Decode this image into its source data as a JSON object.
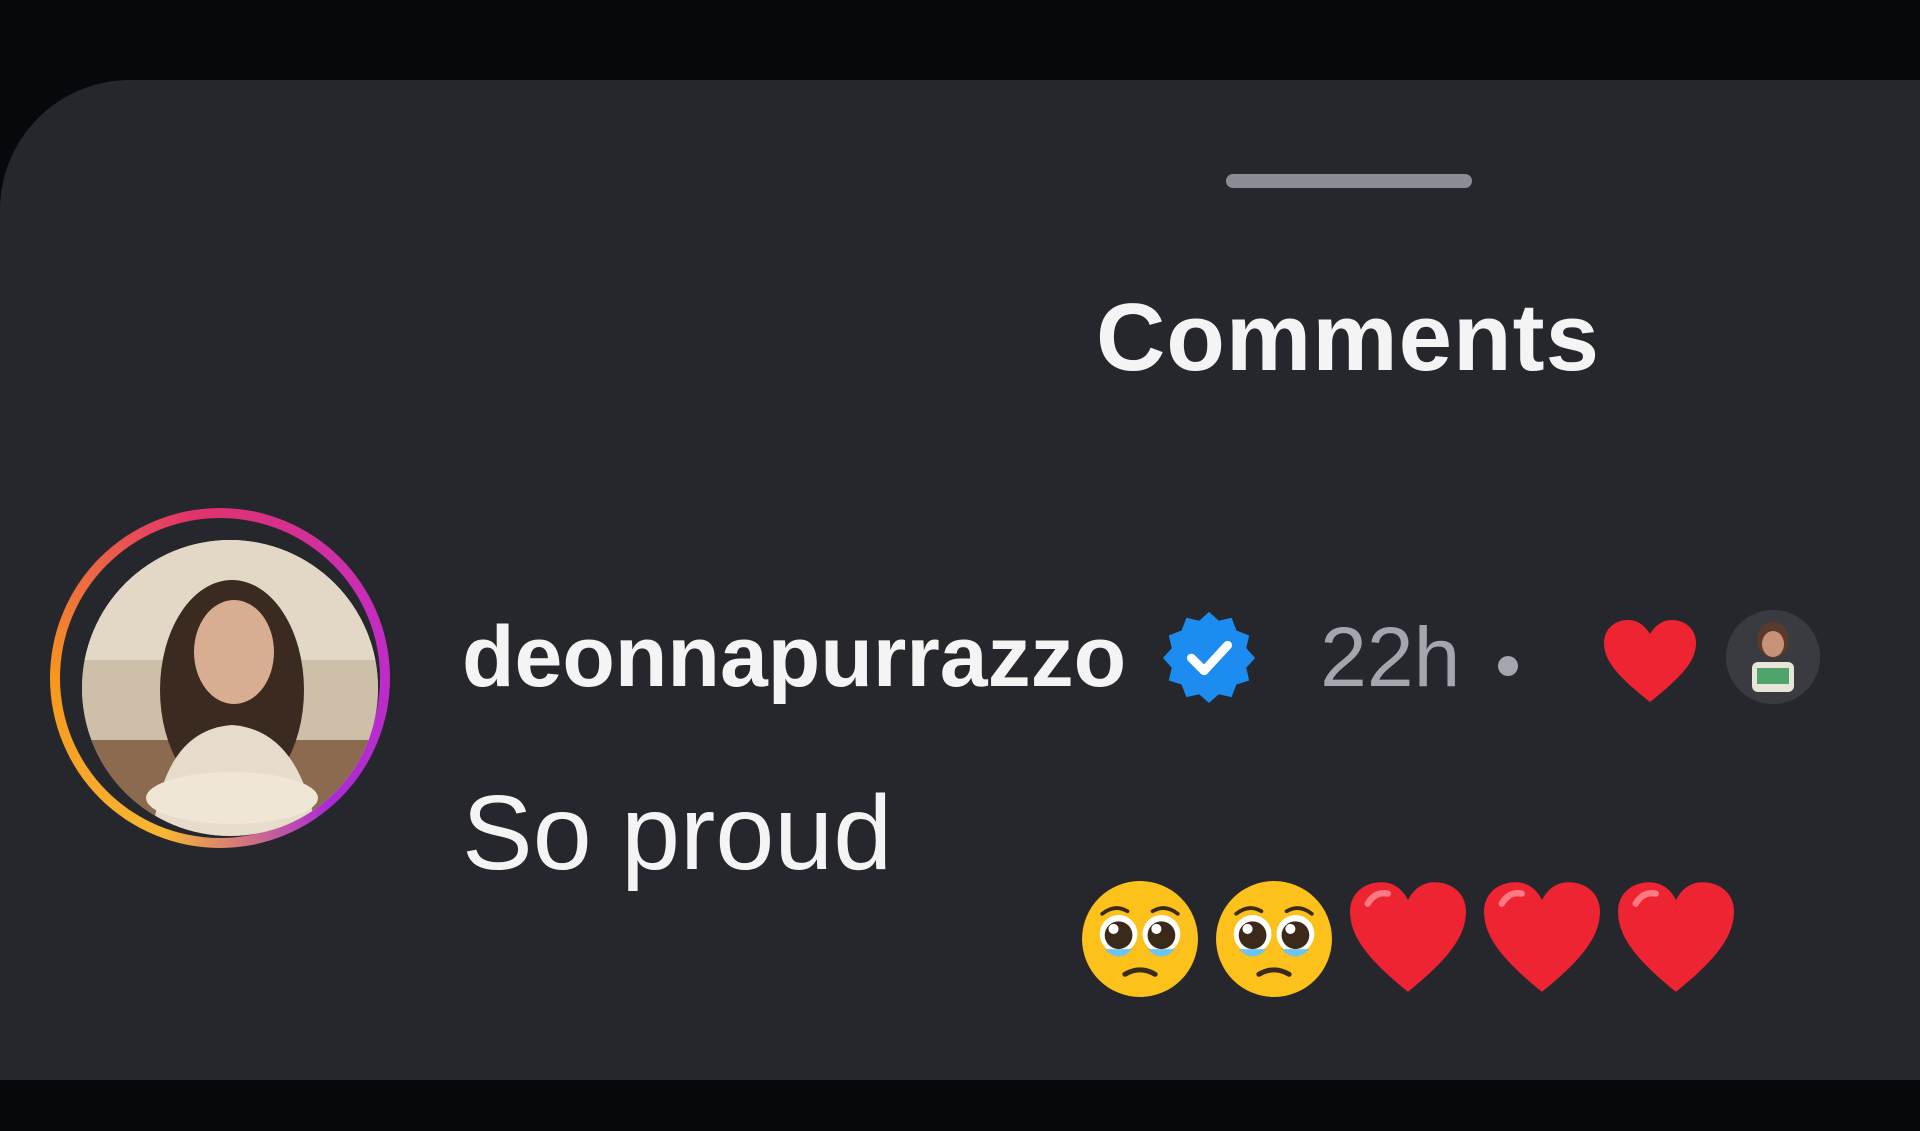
{
  "sheet": {
    "title": "Comments"
  },
  "comment": {
    "username": "deonnapurrazzo",
    "verified": true,
    "timestamp": "22h",
    "liked_by_author": true,
    "text": "So proud",
    "emojis": [
      "pleading-face",
      "pleading-face",
      "red-heart",
      "red-heart",
      "red-heart"
    ]
  },
  "colors": {
    "sheet_background": "#25272c",
    "verified_badge": "#1d8cf0",
    "heart": "#ee2432",
    "story_ring_start": "#f7b733",
    "story_ring_end": "#c62cc0"
  }
}
